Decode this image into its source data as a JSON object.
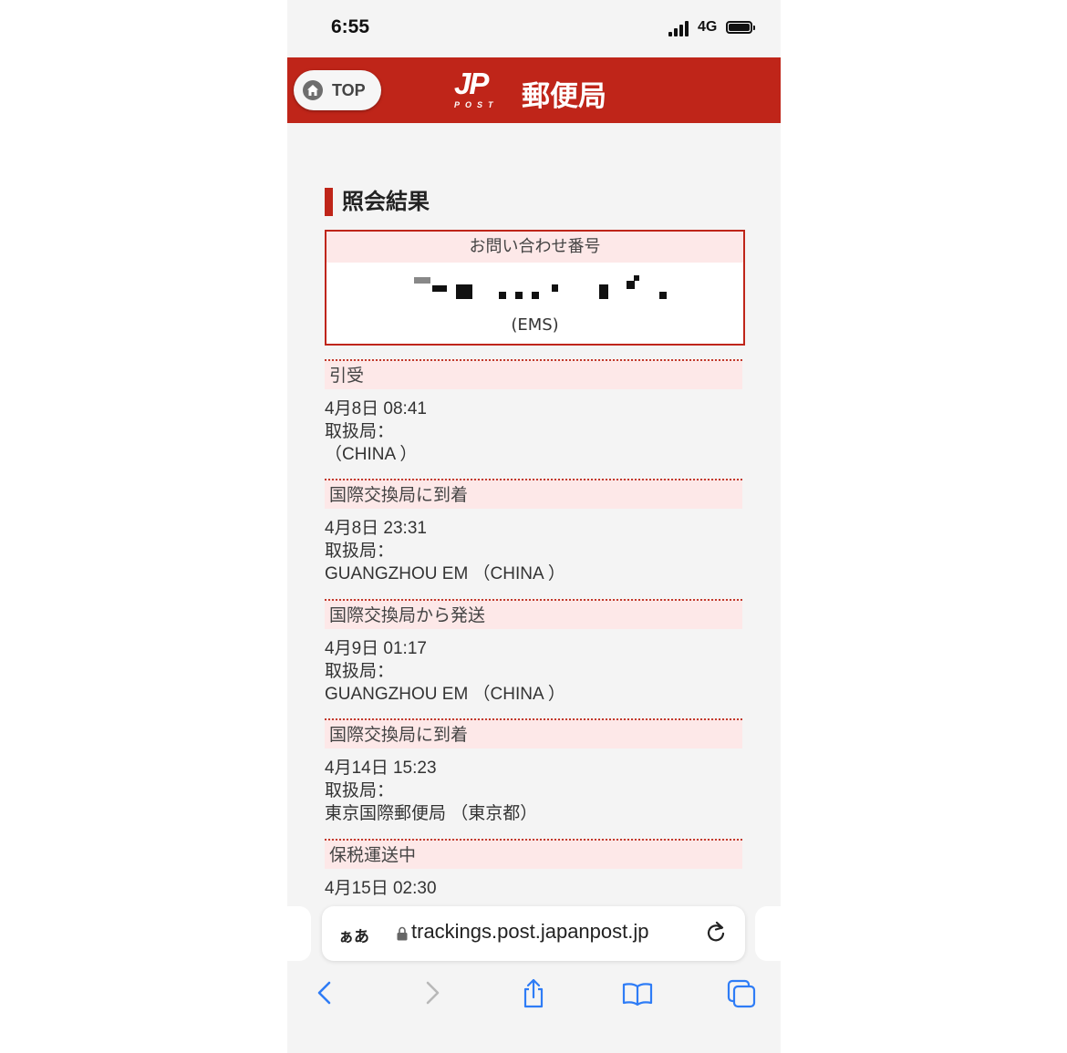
{
  "status_bar": {
    "time": "6:55",
    "network": "4G"
  },
  "header": {
    "top_button": "TOP",
    "logo_text": "JP",
    "logo_subtext": "POST",
    "brand": "郵便局"
  },
  "page_title": "照会結果",
  "inquiry": {
    "label": "お問い合わせ番号",
    "service": "(EMS)"
  },
  "events": [
    {
      "status": "引受",
      "datetime": "4月8日 08:41",
      "office_label": "取扱局：",
      "office": "（CHINA ）"
    },
    {
      "status": "国際交換局に到着",
      "datetime": "4月8日 23:31",
      "office_label": "取扱局：",
      "office": "GUANGZHOU EM （CHINA ）"
    },
    {
      "status": "国際交換局から発送",
      "datetime": "4月9日 01:17",
      "office_label": "取扱局：",
      "office": "GUANGZHOU EM （CHINA ）"
    },
    {
      "status": "国際交換局に到着",
      "datetime": "4月14日 15:23",
      "office_label": "取扱局：",
      "office": "東京国際郵便局 （東京都）"
    },
    {
      "status": "保税運送中",
      "datetime": "4月15日 02:30"
    }
  ],
  "browser": {
    "aa_label": "ぁあ",
    "url": "trackings.post.japanpost.jp"
  },
  "colors": {
    "brand_red": "#bf2519",
    "row_pink": "#fde8e8"
  },
  "icons": [
    "home-icon",
    "lock-icon",
    "reload-icon",
    "back-icon",
    "forward-icon",
    "share-icon",
    "bookmarks-icon",
    "tabs-icon"
  ]
}
